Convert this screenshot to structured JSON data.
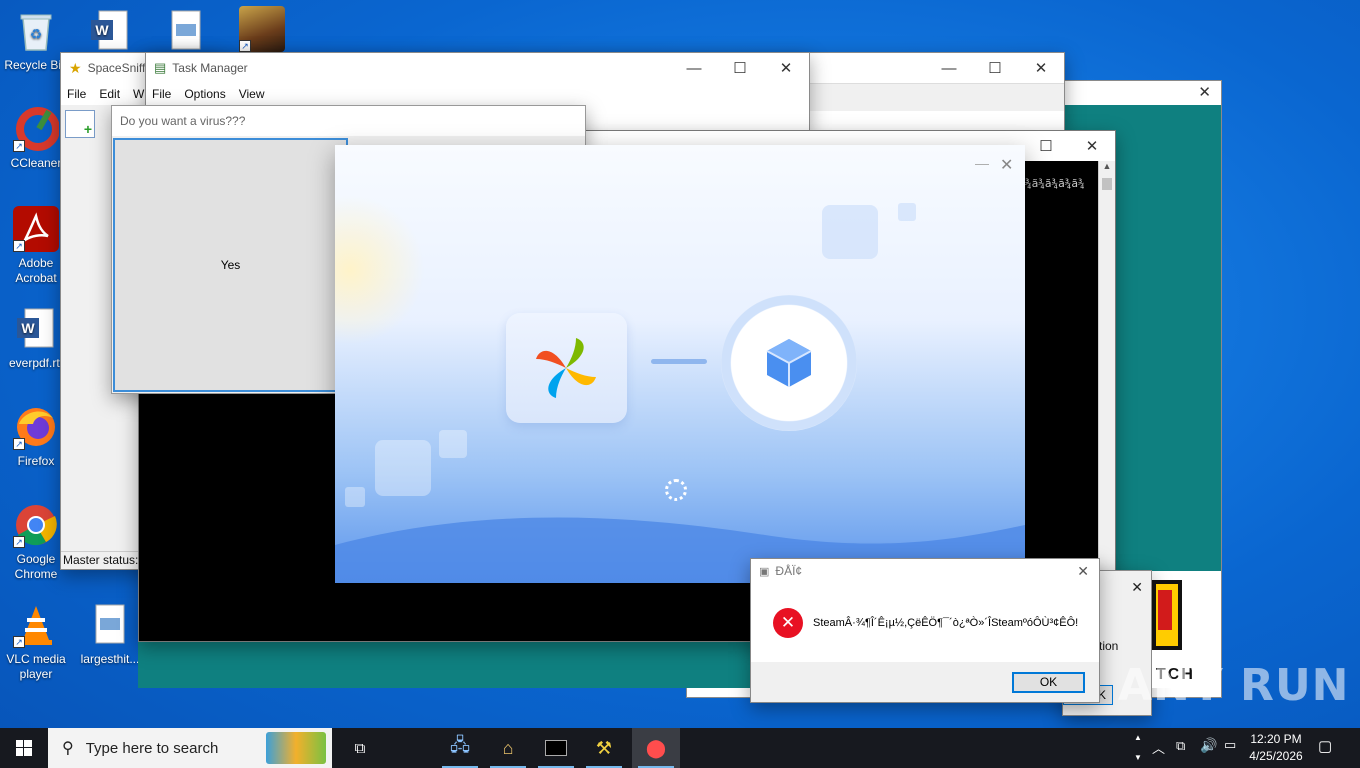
{
  "desktop": {
    "icons": [
      {
        "label": "Recycle Bin"
      },
      {
        "label": "CCleaner"
      },
      {
        "label": "Adobe Acrobat"
      },
      {
        "label": "everpdf.rtf"
      },
      {
        "label": "Firefox"
      },
      {
        "label": "Google Chrome"
      },
      {
        "label": "VLC media player"
      },
      {
        "label": "largesthit..."
      }
    ]
  },
  "spacesniffer": {
    "title": "SpaceSniff",
    "menu": [
      "File",
      "Edit",
      "W"
    ],
    "status": "Master status:"
  },
  "taskmanager": {
    "title": "Task Manager",
    "menu": [
      "File",
      "Options",
      "View"
    ]
  },
  "virus_prompt": {
    "question": "Do you want a virus???",
    "yes_label": "Yes"
  },
  "console": {
    "garbled": "¾ã¾ã¾ã¾ã¾"
  },
  "installer": {
    "min": "—",
    "close": "✕"
  },
  "error_dialog": {
    "title": "ÐÅÏ¢",
    "message": "SteamÂ·¾¶Î´Ê¡µ½,ÇëÊÖ¶¯´ò¿ªÒ»´ÎSteamºóÔÙ³¢ÊÔ!",
    "ok_label": "OK"
  },
  "back_dialog": {
    "partial_text": "tion",
    "partial_ok": "K",
    "partial_logo": "TCH"
  },
  "watermark": "ANY RUN",
  "taskbar": {
    "search_placeholder": "Type here to search",
    "time": "12:20 PM",
    "date": "4/25/2026"
  },
  "colors": {
    "accent": "#0078d7",
    "error_red": "#e81123",
    "teal": "#0f8080"
  }
}
